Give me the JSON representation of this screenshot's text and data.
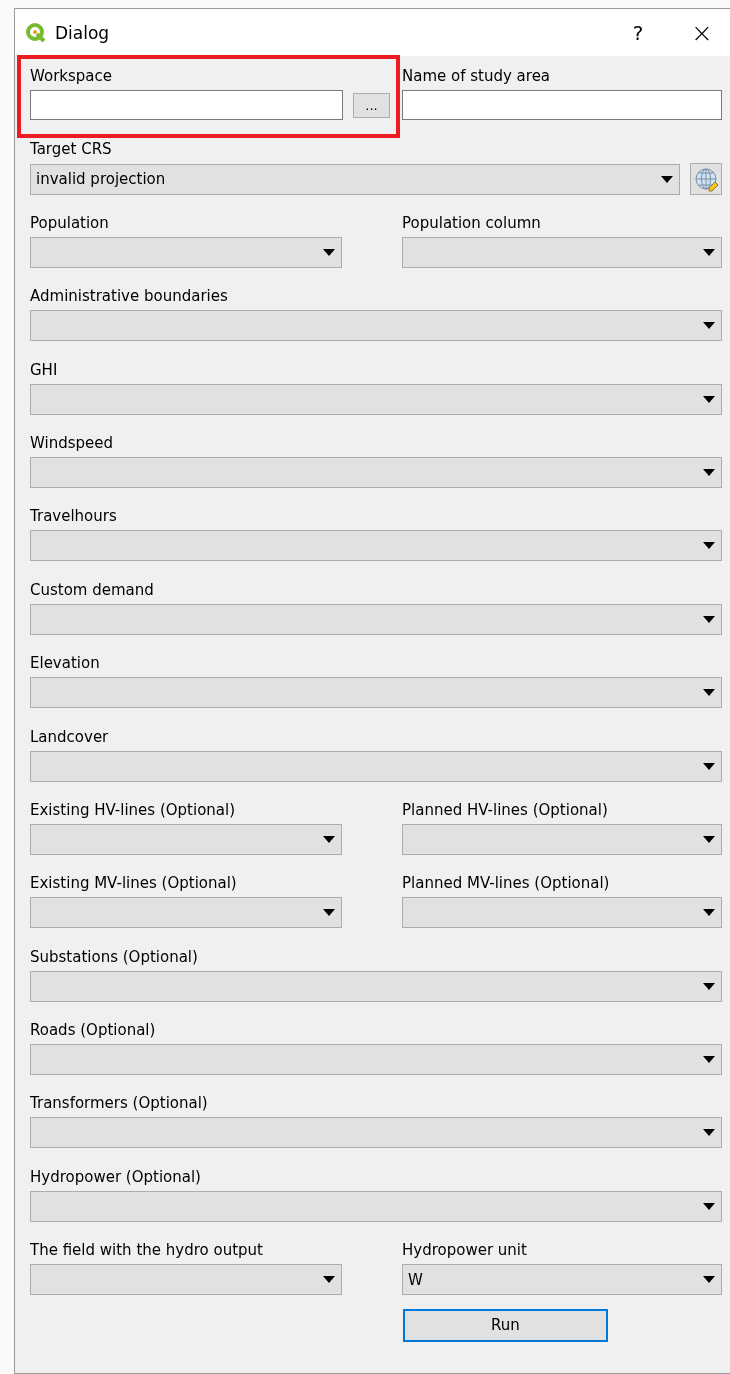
{
  "window": {
    "title": "Dialog",
    "help": "?",
    "close": "×"
  },
  "rows": [
    {
      "fields": [
        {
          "kind": "browse",
          "label": "Workspace",
          "button": "...",
          "highlighted": true
        },
        {
          "kind": "text",
          "label": "Name of study area",
          "highlighted": false
        }
      ]
    },
    {
      "fields": [
        {
          "kind": "crs",
          "label": "Target CRS",
          "value": "invalid projection"
        }
      ]
    },
    {
      "fields": [
        {
          "kind": "combo",
          "label": "Population"
        },
        {
          "kind": "combo",
          "label": "Population column"
        }
      ]
    },
    {
      "fields": [
        {
          "kind": "combo",
          "label": "Administrative boundaries"
        }
      ]
    },
    {
      "fields": [
        {
          "kind": "combo",
          "label": "GHI"
        }
      ]
    },
    {
      "fields": [
        {
          "kind": "combo",
          "label": "Windspeed"
        }
      ]
    },
    {
      "fields": [
        {
          "kind": "combo",
          "label": "Travelhours"
        }
      ]
    },
    {
      "fields": [
        {
          "kind": "combo",
          "label": "Custom demand"
        }
      ]
    },
    {
      "fields": [
        {
          "kind": "combo",
          "label": "Elevation"
        }
      ]
    },
    {
      "fields": [
        {
          "kind": "combo",
          "label": "Landcover"
        }
      ]
    },
    {
      "fields": [
        {
          "kind": "combo",
          "label": "Existing HV-lines (Optional)"
        },
        {
          "kind": "combo",
          "label": "Planned HV-lines (Optional)"
        }
      ]
    },
    {
      "fields": [
        {
          "kind": "combo",
          "label": "Existing MV-lines (Optional)"
        },
        {
          "kind": "combo",
          "label": "Planned MV-lines (Optional)"
        }
      ]
    },
    {
      "fields": [
        {
          "kind": "combo",
          "label": "Substations (Optional)"
        }
      ]
    },
    {
      "fields": [
        {
          "kind": "combo",
          "label": "Roads (Optional)"
        }
      ]
    },
    {
      "fields": [
        {
          "kind": "combo",
          "label": "Transformers (Optional)"
        }
      ]
    },
    {
      "fields": [
        {
          "kind": "combo",
          "label": "Hydropower (Optional)"
        }
      ]
    },
    {
      "fields": [
        {
          "kind": "combo",
          "label": "The field with the hydro output"
        },
        {
          "kind": "combo",
          "label": "Hydropower unit",
          "value": "W"
        }
      ]
    }
  ],
  "run_button": "Run"
}
